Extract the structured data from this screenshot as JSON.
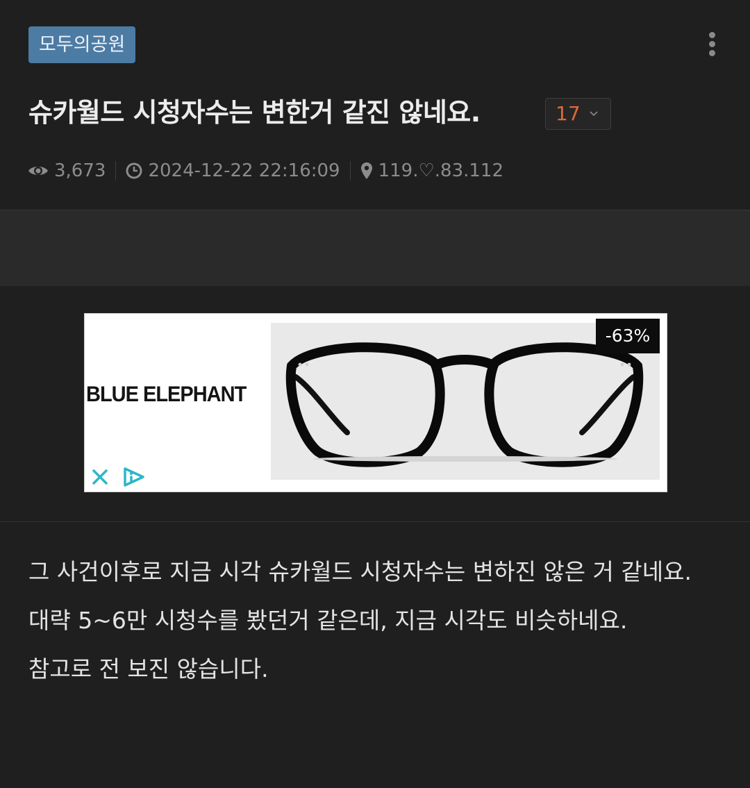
{
  "post": {
    "category": "모두의공원",
    "title": "슈카월드 시청자수는 변한거 같진 않네요.",
    "comment_count": "17",
    "views": "3,673",
    "datetime": "2024-12-22 22:16:09",
    "ip": "119.♡.83.112",
    "more_icon": "vertical-dots-icon",
    "view_icon": "eye-icon",
    "time_icon": "clock-icon",
    "location_icon": "map-pin-icon"
  },
  "ad": {
    "brand": "BLUE ELEPHANT",
    "discount": "-63%",
    "close_icon": "close-icon",
    "info_icon": "ad-choices-icon",
    "accent_color": "#2bb7c8"
  },
  "content": {
    "paragraphs": [
      "그 사건이후로 지금 시각 슈카월드 시청자수는 변하진 않은 거 같네요.",
      "대략 5~6만 시청수를 봤던거 같은데, 지금 시각도 비슷하네요.",
      "참고로 전 보진 않습니다."
    ]
  },
  "colors": {
    "background": "#1f1f1f",
    "category_badge": "#4c7ba4",
    "comment_count": "#e0683a"
  }
}
